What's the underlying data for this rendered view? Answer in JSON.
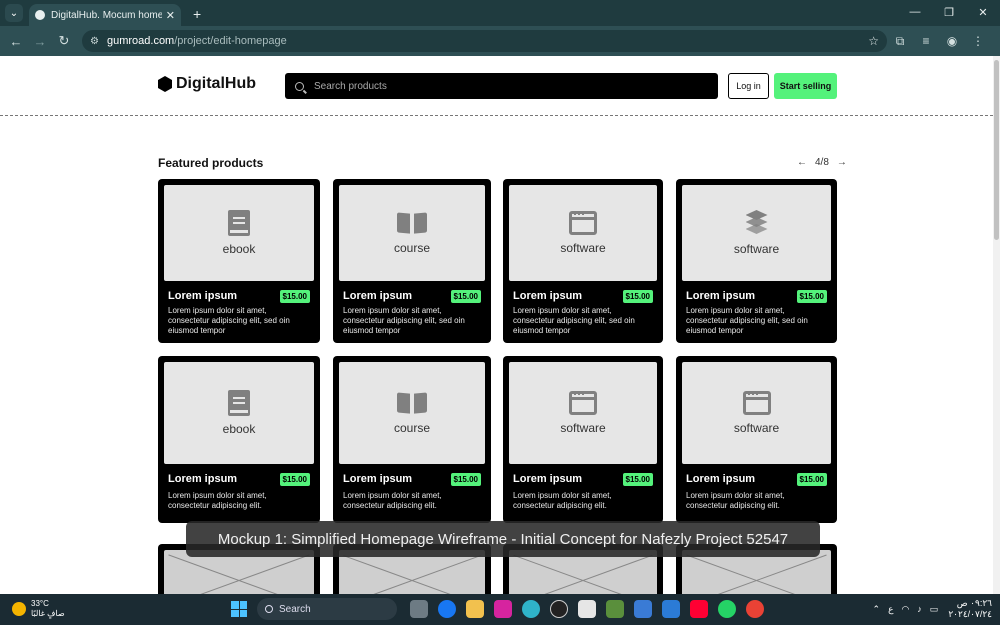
{
  "browser": {
    "tab_title": "DigitalHub. Mocum homepage",
    "new_tab": "+",
    "url_host": "gumroad.com",
    "url_path": "/project/edit-homepage"
  },
  "site": {
    "logo": "DigitalHub",
    "search_placeholder": "Search products",
    "login": "Log in",
    "start_selling": "Start selling"
  },
  "featured": {
    "title": "Featured products",
    "page": "4/8",
    "products": [
      {
        "type": "ebook",
        "icon": "book-icon",
        "name": "Lorem ipsum",
        "price": "$15.00",
        "desc": "Lorem ipsum dolor sit amet, consectetur adipiscing elit, sed oin eiusmod tempor"
      },
      {
        "type": "course",
        "icon": "open-book-icon",
        "name": "Lorem ipsum",
        "price": "$15.00",
        "desc": "Lorem ipsum dolor sit amet, consectetur adipiscing elit, sed oin eiusmod tempor"
      },
      {
        "type": "software",
        "icon": "browser-window-icon",
        "name": "Lorem ipsum",
        "price": "$15.00",
        "desc": "Lorem ipsum dolor sit amet, consectetur adipiscing elit, sed oin eiusmod tempor"
      },
      {
        "type": "software",
        "icon": "layers-icon",
        "name": "Lorem ipsum",
        "price": "$15.00",
        "desc": "Lorem ipsum dolor sit amet, consectetur adipiscing elit, sed oin eiusmod tempor"
      },
      {
        "type": "ebook",
        "icon": "book-icon",
        "name": "Lorem ipsum",
        "price": "$15.00",
        "desc": "Lorem ipsum dolor sit amet, consectetur adipiscing elit."
      },
      {
        "type": "course",
        "icon": "open-book-icon",
        "name": "Lorem ipsum",
        "price": "$15.00",
        "desc": "Lorem ipsum dolor sit amet, consectetur adipiscing elit."
      },
      {
        "type": "software",
        "icon": "browser-window-icon",
        "name": "Lorem ipsum",
        "price": "$15.00",
        "desc": "Lorem ipsum dolor sit amet, consectetur adipiscing elit."
      },
      {
        "type": "software",
        "icon": "browser-window-icon",
        "name": "Lorem ipsum",
        "price": "$15.00",
        "desc": "Lorem ipsum dolor sit amet, consectetur adipiscing elit."
      }
    ]
  },
  "caption": "Mockup 1: Simplified Homepage Wireframe - Initial Concept for Nafezly Project 52547",
  "taskbar": {
    "temperature": "33°C",
    "weather_text": "صافٍ غالبًا",
    "search": "Search",
    "time": "٠٩:٢٦ ص",
    "date": "٢٠٢٤/٠٧/٢٤",
    "lang": "ع"
  },
  "colors": {
    "accent_green": "#54f27b",
    "card_bg": "#000000",
    "chrome_bg": "#1f3b3f"
  }
}
